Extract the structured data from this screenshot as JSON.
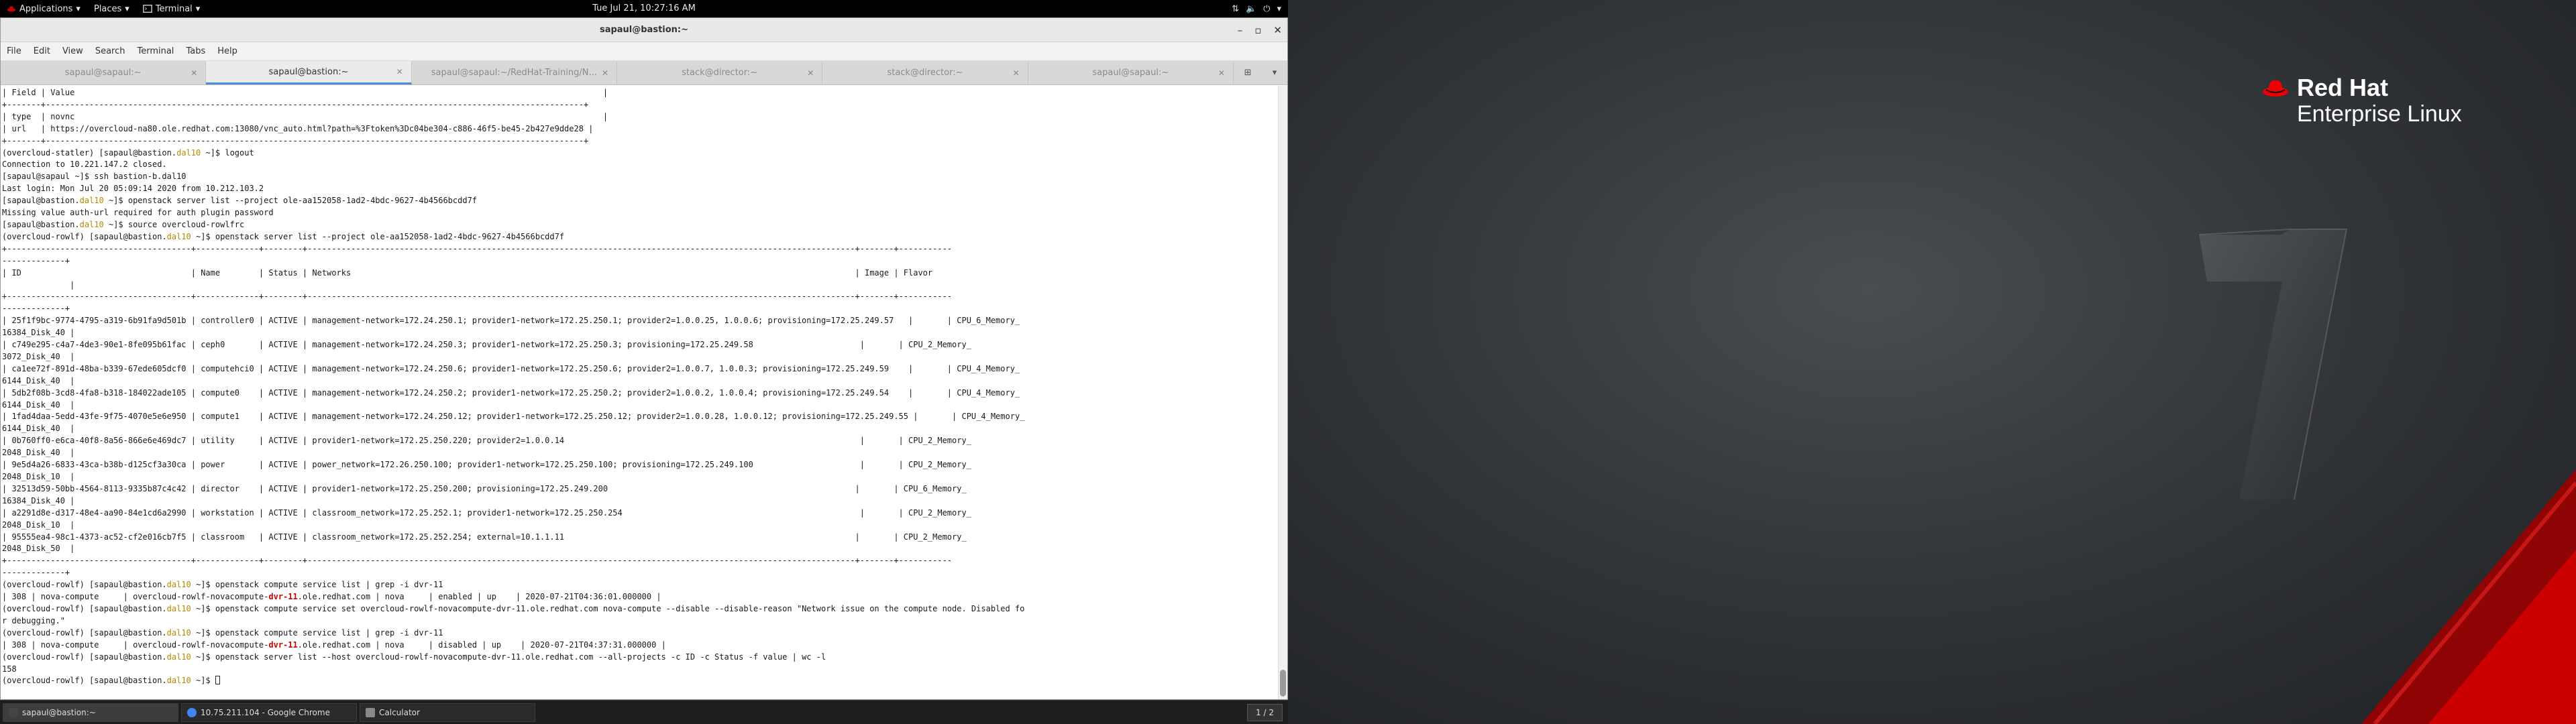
{
  "topbar": {
    "applications": "Applications",
    "places": "Places",
    "terminal": "Terminal",
    "clock": "Tue Jul 21, 10:27:16 AM"
  },
  "window": {
    "title": "sapaul@bastion:~",
    "minimize": "–",
    "maximize": "▫",
    "close": "✕"
  },
  "menu": [
    "File",
    "Edit",
    "View",
    "Search",
    "Terminal",
    "Tabs",
    "Help"
  ],
  "tabs": [
    {
      "label": "sapaul@sapaul:~",
      "active": false
    },
    {
      "label": "sapaul@bastion:~",
      "active": true
    },
    {
      "label": "sapaul@sapaul:~/RedHat-Training/N...",
      "active": false
    },
    {
      "label": "stack@director:~",
      "active": false
    },
    {
      "label": "stack@director:~",
      "active": false
    },
    {
      "label": "sapaul@sapaul:~",
      "active": false
    }
  ],
  "terminal_lines": [
    {
      "parts": [
        {
          "t": "| Field | Value                                                                                                             |"
        }
      ]
    },
    {
      "parts": [
        {
          "t": "+-------+---------------------------------------------------------------------------------------------------------------+"
        }
      ]
    },
    {
      "parts": [
        {
          "t": "| type  | novnc                                                                                                             |"
        }
      ]
    },
    {
      "parts": [
        {
          "t": "| url   | https://overcloud-na80.ole.redhat.com:13080/vnc_auto.html?path=%3Ftoken%3Dc04be304-c886-46f5-be45-2b427e9dde28 |"
        }
      ]
    },
    {
      "parts": [
        {
          "t": "+-------+---------------------------------------------------------------------------------------------------------------+"
        }
      ]
    },
    {
      "parts": [
        {
          "t": "(overcloud-statler) [sapaul@bastion."
        },
        {
          "t": "dal10",
          "c": "y"
        },
        {
          "t": " ~]$ logout"
        }
      ]
    },
    {
      "parts": [
        {
          "t": "Connection to 10.221.147.2 closed."
        }
      ]
    },
    {
      "parts": [
        {
          "t": "[sapaul@sapaul ~]$ ssh bastion-b.dal10"
        }
      ]
    },
    {
      "parts": [
        {
          "t": "Last login: Mon Jul 20 05:09:14 2020 from 10.212.103.2"
        }
      ]
    },
    {
      "parts": [
        {
          "t": "[sapaul@bastion."
        },
        {
          "t": "dal10",
          "c": "y"
        },
        {
          "t": " ~]$ openstack server list --project ole-aa152058-1ad2-4bdc-9627-4b4566bcdd7f"
        }
      ]
    },
    {
      "parts": [
        {
          "t": "Missing value auth-url required for auth plugin password"
        }
      ]
    },
    {
      "parts": [
        {
          "t": "[sapaul@bastion."
        },
        {
          "t": "dal10",
          "c": "y"
        },
        {
          "t": " ~]$ source overcloud-rowlfrc"
        }
      ]
    },
    {
      "parts": [
        {
          "t": "(overcloud-rowlf) [sapaul@bastion."
        },
        {
          "t": "dal10",
          "c": "y"
        },
        {
          "t": " ~]$ openstack server list --project ole-aa152058-1ad2-4bdc-9627-4b4566bcdd7f"
        }
      ]
    },
    {
      "parts": [
        {
          "t": "+--------------------------------------+-------------+--------+-----------------------------------------------------------------------------------------------------------------+-------+-----------"
        }
      ]
    },
    {
      "parts": [
        {
          "t": "-------------+"
        }
      ]
    },
    {
      "parts": [
        {
          "t": "| ID                                   | Name        | Status | Networks                                                                                                        | Image | Flavor"
        }
      ]
    },
    {
      "parts": [
        {
          "t": "              |"
        }
      ]
    },
    {
      "parts": [
        {
          "t": "+--------------------------------------+-------------+--------+-----------------------------------------------------------------------------------------------------------------+-------+-----------"
        }
      ]
    },
    {
      "parts": [
        {
          "t": "-------------+"
        }
      ]
    },
    {
      "parts": [
        {
          "t": "| 25f1f9bc-9774-4795-a319-6b91fa9d501b | controller0 | ACTIVE | management-network=172.24.250.1; provider1-network=172.25.250.1; provider2=1.0.0.25, 1.0.0.6; provisioning=172.25.249.57   |       | CPU_6_Memory_"
        }
      ]
    },
    {
      "parts": [
        {
          "t": "16384_Disk_40 |"
        }
      ]
    },
    {
      "parts": [
        {
          "t": "| c749e295-c4a7-4de3-90e1-8fe095b61fac | ceph0       | ACTIVE | management-network=172.24.250.3; provider1-network=172.25.250.3; provisioning=172.25.249.58                      |       | CPU_2_Memory_"
        }
      ]
    },
    {
      "parts": [
        {
          "t": "3072_Disk_40  |"
        }
      ]
    },
    {
      "parts": [
        {
          "t": "| ca1ee72f-891d-48ba-b339-67ede605dcf0 | computehci0 | ACTIVE | management-network=172.24.250.6; provider1-network=172.25.250.6; provider2=1.0.0.7, 1.0.0.3; provisioning=172.25.249.59    |       | CPU_4_Memory_"
        }
      ]
    },
    {
      "parts": [
        {
          "t": "6144_Disk_40  |"
        }
      ]
    },
    {
      "parts": [
        {
          "t": "| 5db2f08b-3cd8-4fa8-b318-184022ade105 | compute0    | ACTIVE | management-network=172.24.250.2; provider1-network=172.25.250.2; provider2=1.0.0.2, 1.0.0.4; provisioning=172.25.249.54    |       | CPU_4_Memory_"
        }
      ]
    },
    {
      "parts": [
        {
          "t": "6144_Disk_40  |"
        }
      ]
    },
    {
      "parts": [
        {
          "t": "| 1fad4daa-5edd-43fe-9f75-4070e5e6e950 | compute1    | ACTIVE | management-network=172.24.250.12; provider1-network=172.25.250.12; provider2=1.0.0.28, 1.0.0.12; provisioning=172.25.249.55 |       | CPU_4_Memory_"
        }
      ]
    },
    {
      "parts": [
        {
          "t": "6144_Disk_40  |"
        }
      ]
    },
    {
      "parts": [
        {
          "t": "| 0b760ff0-e6ca-40f8-8a56-866e6e469dc7 | utility     | ACTIVE | provider1-network=172.25.250.220; provider2=1.0.0.14                                                             |       | CPU_2_Memory_"
        }
      ]
    },
    {
      "parts": [
        {
          "t": "2048_Disk_40  |"
        }
      ]
    },
    {
      "parts": [
        {
          "t": "| 9e5d4a26-6833-43ca-b38b-d125cf3a30ca | power       | ACTIVE | power_network=172.26.250.100; provider1-network=172.25.250.100; provisioning=172.25.249.100                      |       | CPU_2_Memory_"
        }
      ]
    },
    {
      "parts": [
        {
          "t": "2048_Disk_10  |"
        }
      ]
    },
    {
      "parts": [
        {
          "t": "| 32513d59-50bb-4564-8113-9335b87c4c42 | director    | ACTIVE | provider1-network=172.25.250.200; provisioning=172.25.249.200                                                   |       | CPU_6_Memory_"
        }
      ]
    },
    {
      "parts": [
        {
          "t": "16384_Disk_40 |"
        }
      ]
    },
    {
      "parts": [
        {
          "t": "| a2291d8e-d317-48e4-aa90-84e1cd6a2990 | workstation | ACTIVE | classroom_network=172.25.252.1; provider1-network=172.25.250.254                                                 |       | CPU_2_Memory_"
        }
      ]
    },
    {
      "parts": [
        {
          "t": "2048_Disk_10  |"
        }
      ]
    },
    {
      "parts": [
        {
          "t": "| 95555ea4-98c1-4373-ac52-cf2e016cb7f5 | classroom   | ACTIVE | classroom_network=172.25.252.254; external=10.1.1.11                                                            |       | CPU_2_Memory_"
        }
      ]
    },
    {
      "parts": [
        {
          "t": "2048_Disk_50  |"
        }
      ]
    },
    {
      "parts": [
        {
          "t": "+--------------------------------------+-------------+--------+-----------------------------------------------------------------------------------------------------------------+-------+-----------"
        }
      ]
    },
    {
      "parts": [
        {
          "t": "-------------+"
        }
      ]
    },
    {
      "parts": [
        {
          "t": "(overcloud-rowlf) [sapaul@bastion."
        },
        {
          "t": "dal10",
          "c": "y"
        },
        {
          "t": " ~]$ openstack compute service list | grep -i dvr-11"
        }
      ]
    },
    {
      "parts": [
        {
          "t": "| 308 | nova-compute     | overcloud-rowlf-novacompute-"
        },
        {
          "t": "dvr-11",
          "c": "r"
        },
        {
          "t": ".ole.redhat.com | nova     | enabled | up    | 2020-07-21T04:36:01.000000 |"
        }
      ]
    },
    {
      "parts": [
        {
          "t": "(overcloud-rowlf) [sapaul@bastion."
        },
        {
          "t": "dal10",
          "c": "y"
        },
        {
          "t": " ~]$ openstack compute service set overcloud-rowlf-novacompute-dvr-11.ole.redhat.com nova-compute --disable --disable-reason \"Network issue on the compute node. Disabled fo"
        }
      ]
    },
    {
      "parts": [
        {
          "t": "r debugging.\""
        }
      ]
    },
    {
      "parts": [
        {
          "t": "(overcloud-rowlf) [sapaul@bastion."
        },
        {
          "t": "dal10",
          "c": "y"
        },
        {
          "t": " ~]$ openstack compute service list | grep -i dvr-11"
        }
      ]
    },
    {
      "parts": [
        {
          "t": "| 308 | nova-compute     | overcloud-rowlf-novacompute-"
        },
        {
          "t": "dvr-11",
          "c": "r"
        },
        {
          "t": ".ole.redhat.com | nova     | disabled | up    | 2020-07-21T04:37:31.000000 |"
        }
      ]
    },
    {
      "parts": [
        {
          "t": "(overcloud-rowlf) [sapaul@bastion."
        },
        {
          "t": "dal10",
          "c": "y"
        },
        {
          "t": " ~]$ openstack server list --host overcloud-rowlf-novacompute-dvr-11.ole.redhat.com --all-projects -c ID -c Status -f value | wc -l"
        }
      ]
    },
    {
      "parts": [
        {
          "t": "158"
        }
      ]
    },
    {
      "parts": [
        {
          "t": "(overcloud-rowlf) [sapaul@bastion."
        },
        {
          "t": "dal10",
          "c": "y"
        },
        {
          "t": " ~]$ "
        }
      ],
      "cursor": true
    }
  ],
  "taskbar": [
    {
      "label": "sapaul@bastion:~",
      "icon_color": "#444444",
      "active": true
    },
    {
      "label": "10.75.211.104 - Google Chrome",
      "icon_color": "#4285f4",
      "active": false
    },
    {
      "label": "Calculator",
      "icon_color": "#888888",
      "active": false
    }
  ],
  "workspace": "1 / 2",
  "desktop": {
    "brand_line1": "Red Hat",
    "brand_line2": "Enterprise Linux",
    "accent_red": "#cc0000"
  }
}
